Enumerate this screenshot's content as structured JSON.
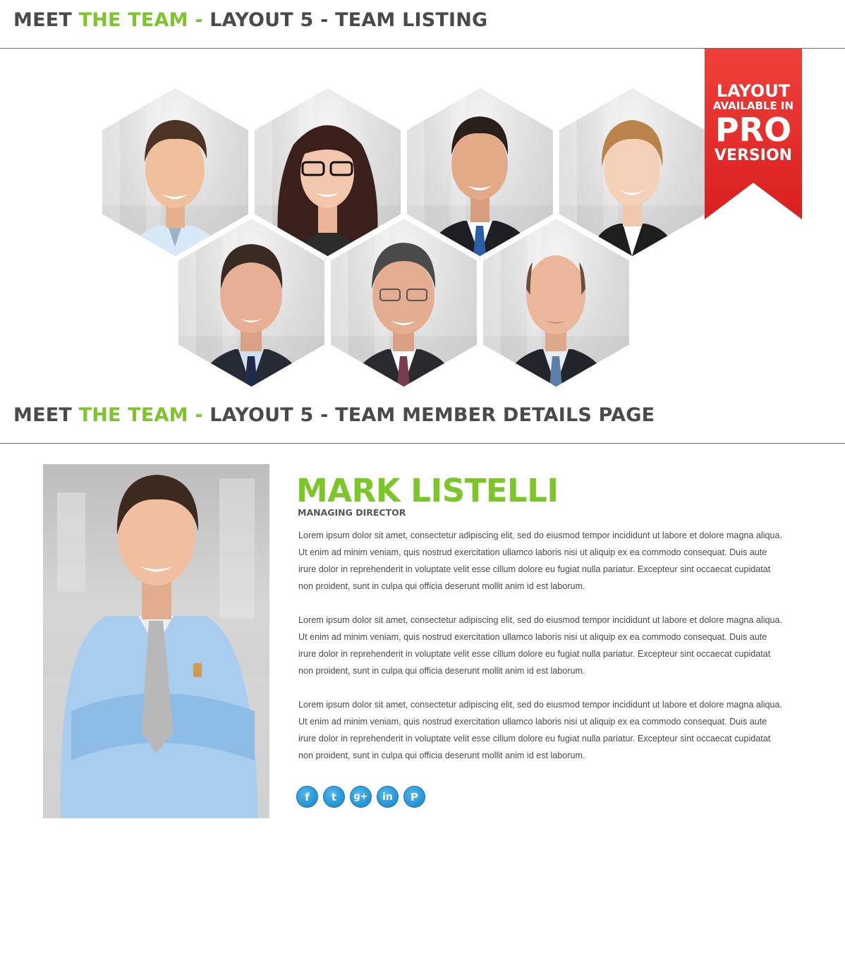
{
  "listing_header": {
    "part1": "MEET ",
    "part2": "THE TEAM - ",
    "part3": "LAYOUT 5 - TEAM LISTING"
  },
  "details_header": {
    "part1": "MEET ",
    "part2": "THE TEAM - ",
    "part3": "LAYOUT 5 - TEAM MEMBER DETAILS PAGE"
  },
  "pro_ribbon": {
    "line1": "LAYOUT",
    "line2": "AVAILABLE IN",
    "line3": "PRO",
    "line4": "VERSION"
  },
  "colors": {
    "accent": "#7cc62a",
    "heading": "#4a4a4a",
    "ribbon": "#e8302b",
    "social": "#2393d6"
  },
  "member": {
    "name": "MARK LISTELLI",
    "role": "MANAGING DIRECTOR",
    "bio": [
      "Lorem ipsum dolor sit amet, consectetur adipiscing elit, sed do eiusmod tempor incididunt ut labore et dolore magna aliqua. Ut enim ad minim veniam, quis nostrud exercitation ullamco laboris nisi ut aliquip ex ea commodo consequat. Duis aute irure dolor in reprehenderit in voluptate velit esse cillum dolore eu fugiat nulla pariatur. Excepteur sint occaecat cupidatat non proident, sunt in culpa qui officia deserunt mollit anim id est laborum.",
      "Lorem ipsum dolor sit amet, consectetur adipiscing elit, sed do eiusmod tempor incididunt ut labore et dolore magna aliqua. Ut enim ad minim veniam, quis nostrud exercitation ullamco laboris nisi ut aliquip ex ea commodo consequat. Duis aute irure dolor in reprehenderit in voluptate velit esse cillum dolore eu fugiat nulla pariatur. Excepteur sint occaecat cupidatat non proident, sunt in culpa qui officia deserunt mollit anim id est laborum.",
      "Lorem ipsum dolor sit amet, consectetur adipiscing elit, sed do eiusmod tempor incididunt ut labore et dolore magna aliqua. Ut enim ad minim veniam, quis nostrud exercitation ullamco laboris nisi ut aliquip ex ea commodo consequat. Duis aute irure dolor in reprehenderit in voluptate velit esse cillum dolore eu fugiat nulla pariatur. Excepteur sint occaecat cupidatat non proident, sunt in culpa qui officia deserunt mollit anim id est laborum."
    ]
  },
  "social": [
    {
      "icon": "facebook-icon",
      "glyph": "f"
    },
    {
      "icon": "twitter-icon",
      "glyph": "t"
    },
    {
      "icon": "google-plus-icon",
      "glyph": "g+"
    },
    {
      "icon": "linkedin-icon",
      "glyph": "in"
    },
    {
      "icon": "pinterest-icon",
      "glyph": "P"
    }
  ]
}
